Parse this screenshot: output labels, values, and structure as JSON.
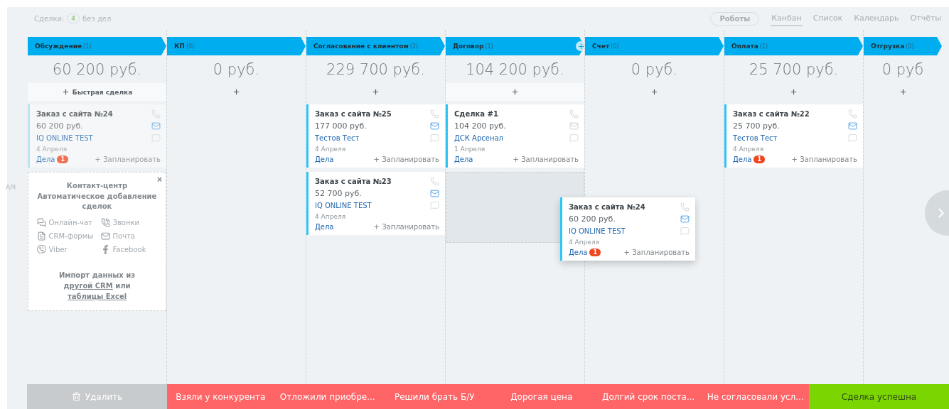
{
  "topbar": {
    "deals_label": "Сделки:",
    "deals_count": "4",
    "deals_suffix": "без дел",
    "robots_button": "Роботы",
    "views": [
      {
        "label": "Канбан",
        "selected": true
      },
      {
        "label": "Список",
        "selected": false
      },
      {
        "label": "Календарь",
        "selected": false
      },
      {
        "label": "Отчёты",
        "selected": false
      }
    ]
  },
  "side_label": "API",
  "columns": [
    {
      "title": "Обсуждение",
      "count": "(1)",
      "sum": "60 200 руб.",
      "add_label": "Быстрая сделка",
      "cards": [
        {
          "title": "Заказ с сайта №24",
          "sum": "60 200 руб.",
          "contact": "IQ ONLINE TEST",
          "date": "4 Апреля",
          "tasks": "Дела",
          "badge": "1",
          "plan": "+ Запланировать",
          "mail_active": true,
          "faded": true
        }
      ],
      "widget": {
        "close": "×",
        "title": "Контакт-центр Автоматическое добавление сделок",
        "channels": [
          {
            "kind": "chat",
            "label": "Онлайн-чат"
          },
          {
            "kind": "calls",
            "label": "Звонки"
          },
          {
            "kind": "forms",
            "label": "CRM-формы"
          },
          {
            "kind": "mail",
            "label": "Почта"
          },
          {
            "kind": "viber",
            "label": "Viber"
          },
          {
            "kind": "facebook",
            "label": "Facebook"
          }
        ],
        "import": [
          {
            "text": "Импорт данных из ",
            "link": false
          },
          {
            "text": "другой CRM",
            "link": true
          },
          {
            "text": " или ",
            "link": false
          },
          {
            "text": "таблицы Excel",
            "link": true
          }
        ]
      }
    },
    {
      "title": "КП",
      "count": "(0)",
      "sum": "0 руб."
    },
    {
      "title": "Согласование с клиентом",
      "count": "(2)",
      "sum": "229 700 руб.",
      "cards": [
        {
          "title": "Заказ с сайта №25",
          "sum": "177 000 руб.",
          "contact": "Тестов Тест",
          "date": "4 Апреля",
          "tasks": "Дела",
          "plan": "+ Запланировать",
          "mail_active": true,
          "faded": false
        },
        {
          "title": "Заказ с сайта №23",
          "sum": "52 700 руб.",
          "contact": "IQ ONLINE TEST",
          "date": "4 Апреля",
          "tasks": "Дела",
          "plan": "+ Запланировать",
          "mail_active": true,
          "faded": false
        }
      ]
    },
    {
      "title": "Договор",
      "count": "(1)",
      "sum": "104 200 руб.",
      "add_button": true,
      "drop_zone": true,
      "cards": [
        {
          "title": "Сделка #1",
          "sum": "104 200 руб.",
          "contact": "ДСК Арсенал",
          "date": "1 Апреля",
          "tasks": "Дела",
          "plan": "+ Запланировать",
          "mail_active": false,
          "faded": false
        }
      ]
    },
    {
      "title": "Счет",
      "count": "(0)",
      "sum": "0 руб."
    },
    {
      "title": "Оплата",
      "count": "(1)",
      "sum": "25 700 руб.",
      "cards": [
        {
          "title": "Заказ с сайта №22",
          "sum": "25 700 руб.",
          "contact": "Тестов Тест",
          "date": "4 Апреля",
          "tasks": "Дела",
          "badge": "1",
          "plan": "+ Запланировать",
          "mail_active": true,
          "faded": false
        }
      ]
    },
    {
      "title": "Отгрузка",
      "count": "(0)",
      "sum": "0 руб"
    }
  ],
  "dragged_card": {
    "title": "Заказ с сайта №24",
    "sum": "60 200 руб.",
    "contact": "IQ ONLINE TEST",
    "date": "4 Апреля",
    "tasks": "Дела",
    "badge": "1",
    "plan": "+ Запланировать",
    "mail_active": true,
    "faded": false
  },
  "actions": [
    {
      "kind": "delete",
      "label": "Удалить"
    },
    {
      "kind": "fail",
      "label": "Взяли у конкурента"
    },
    {
      "kind": "fail",
      "label": "Отложили приобре..."
    },
    {
      "kind": "fail",
      "label": "Решили брать Б/У"
    },
    {
      "kind": "fail",
      "label": "Дорогая цена"
    },
    {
      "kind": "fail",
      "label": "Долгий срок поста..."
    },
    {
      "kind": "fail",
      "label": "Не согласовали усл..."
    },
    {
      "kind": "success",
      "label": "Сделка успешна"
    }
  ]
}
